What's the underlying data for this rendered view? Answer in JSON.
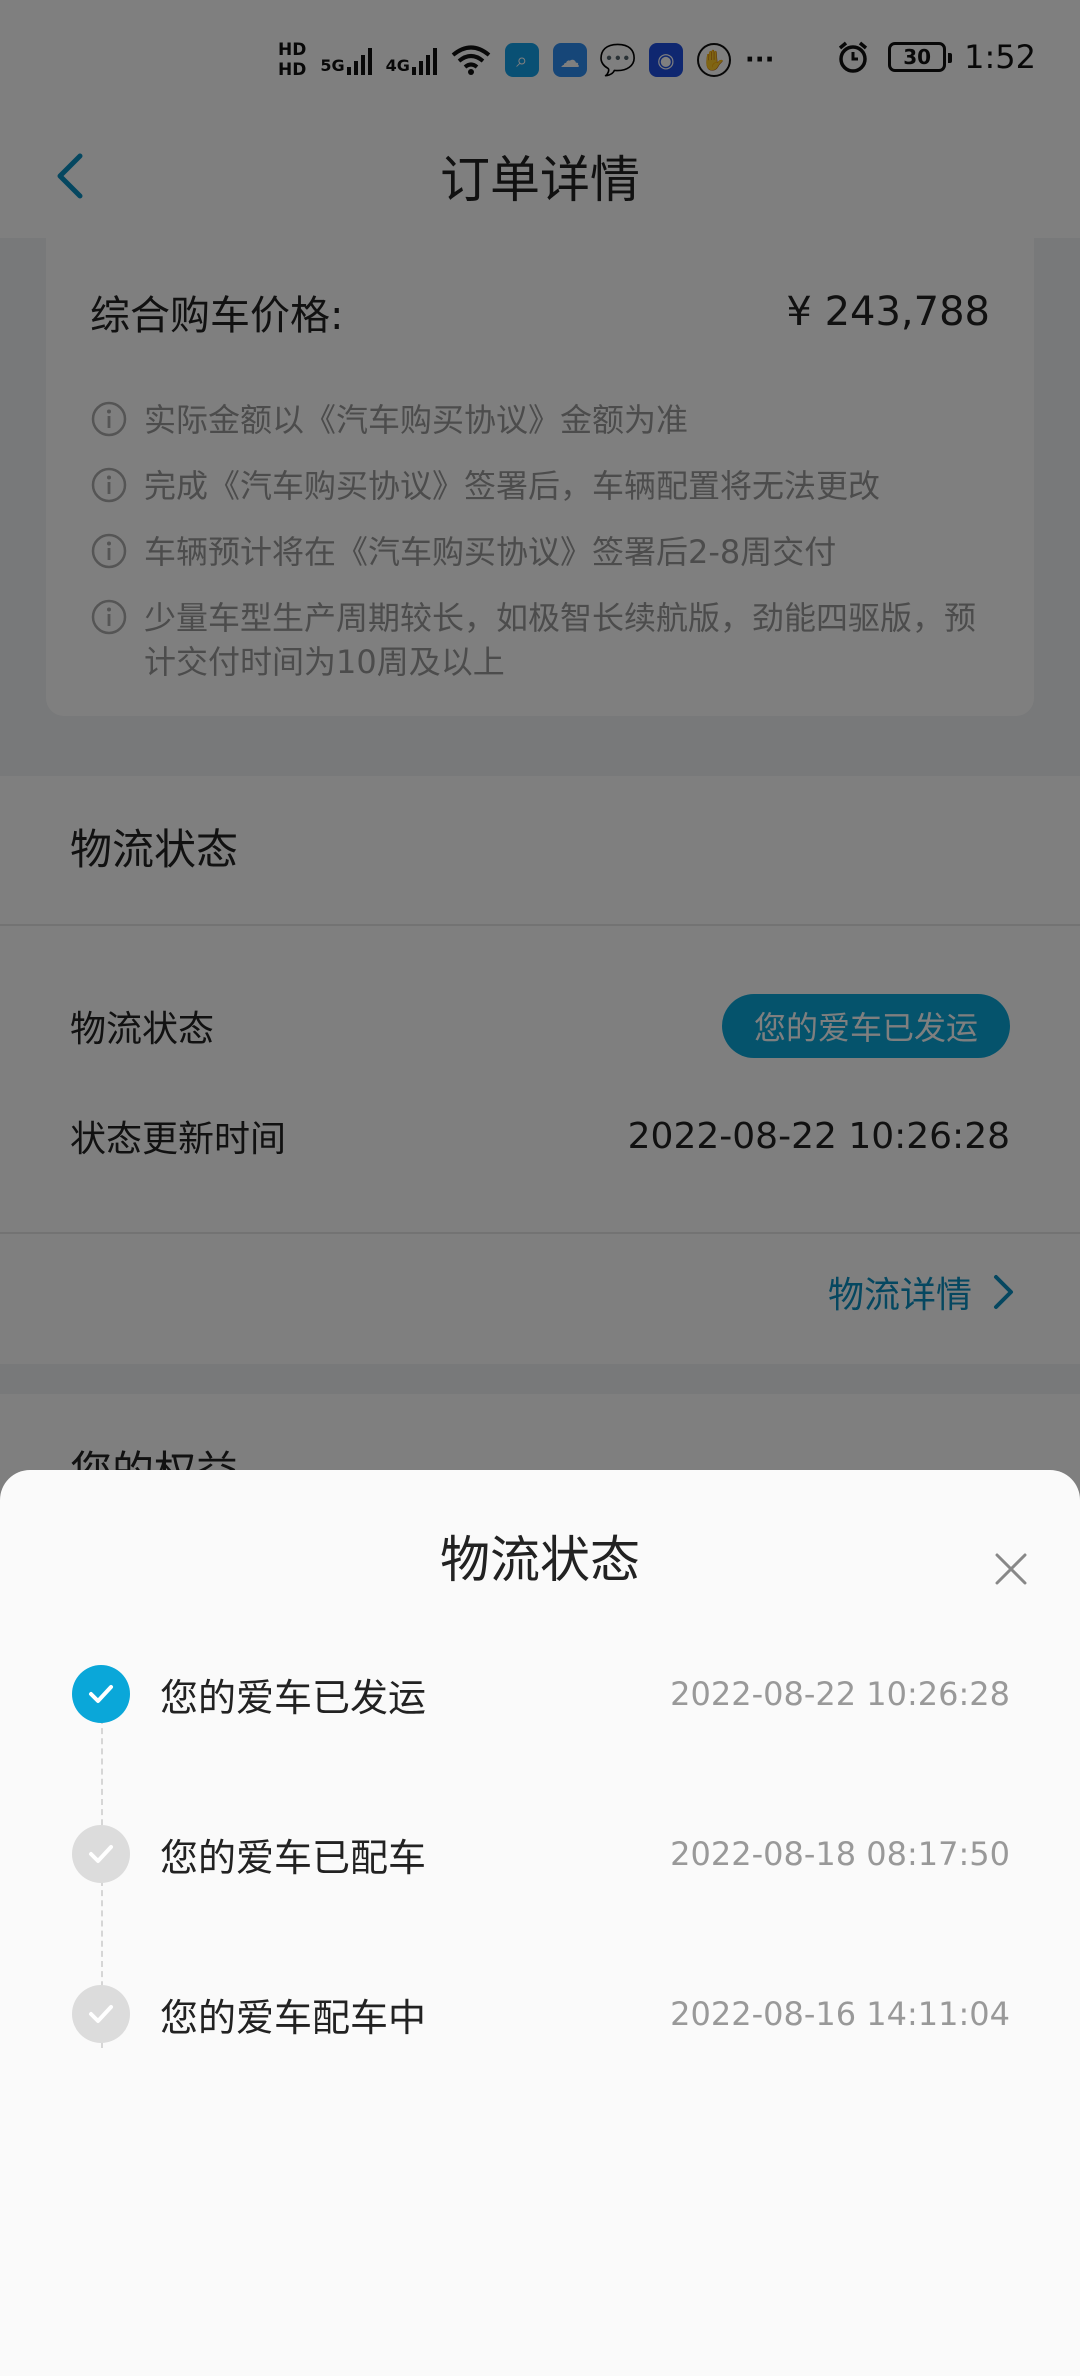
{
  "status_bar": {
    "hd1": "HD",
    "hd2": "HD",
    "sim1_label": "5G",
    "sim2_label": "4G",
    "battery_level": "30",
    "time": "1:52",
    "more": "···"
  },
  "nav": {
    "title": "订单详情"
  },
  "price_card": {
    "label": "综合购车价格:",
    "value": "¥ 243,788",
    "notes": [
      "实际金额以《汽车购买协议》金额为准",
      "完成《汽车购买协议》签署后，车辆配置将无法更改",
      "车辆预计将在《汽车购买协议》签署后2-8周交付",
      "少量车型生产周期较长，如极智长续航版，劲能四驱版，预计交付时间为10周及以上"
    ]
  },
  "logistics": {
    "section_title": "物流状态",
    "status_label": "物流状态",
    "status_value": "您的爱车已发运",
    "update_label": "状态更新时间",
    "update_value": "2022-08-22 10:26:28",
    "details_link": "物流详情"
  },
  "benefits": {
    "title": "您的权益"
  },
  "sheet": {
    "title": "物流状态",
    "items": [
      {
        "label": "您的爱车已发运",
        "time": "2022-08-22 10:26:28",
        "state": "active"
      },
      {
        "label": "您的爱车已配车",
        "time": "2022-08-18 08:17:50",
        "state": "done"
      },
      {
        "label": "您的爱车配车中",
        "time": "2022-08-16 14:11:04",
        "state": "done"
      }
    ]
  },
  "colors": {
    "accent": "#0aa7d9",
    "link": "#0a8fc1",
    "muted_text": "#999999",
    "inactive_dot": "#dcdcdc"
  }
}
